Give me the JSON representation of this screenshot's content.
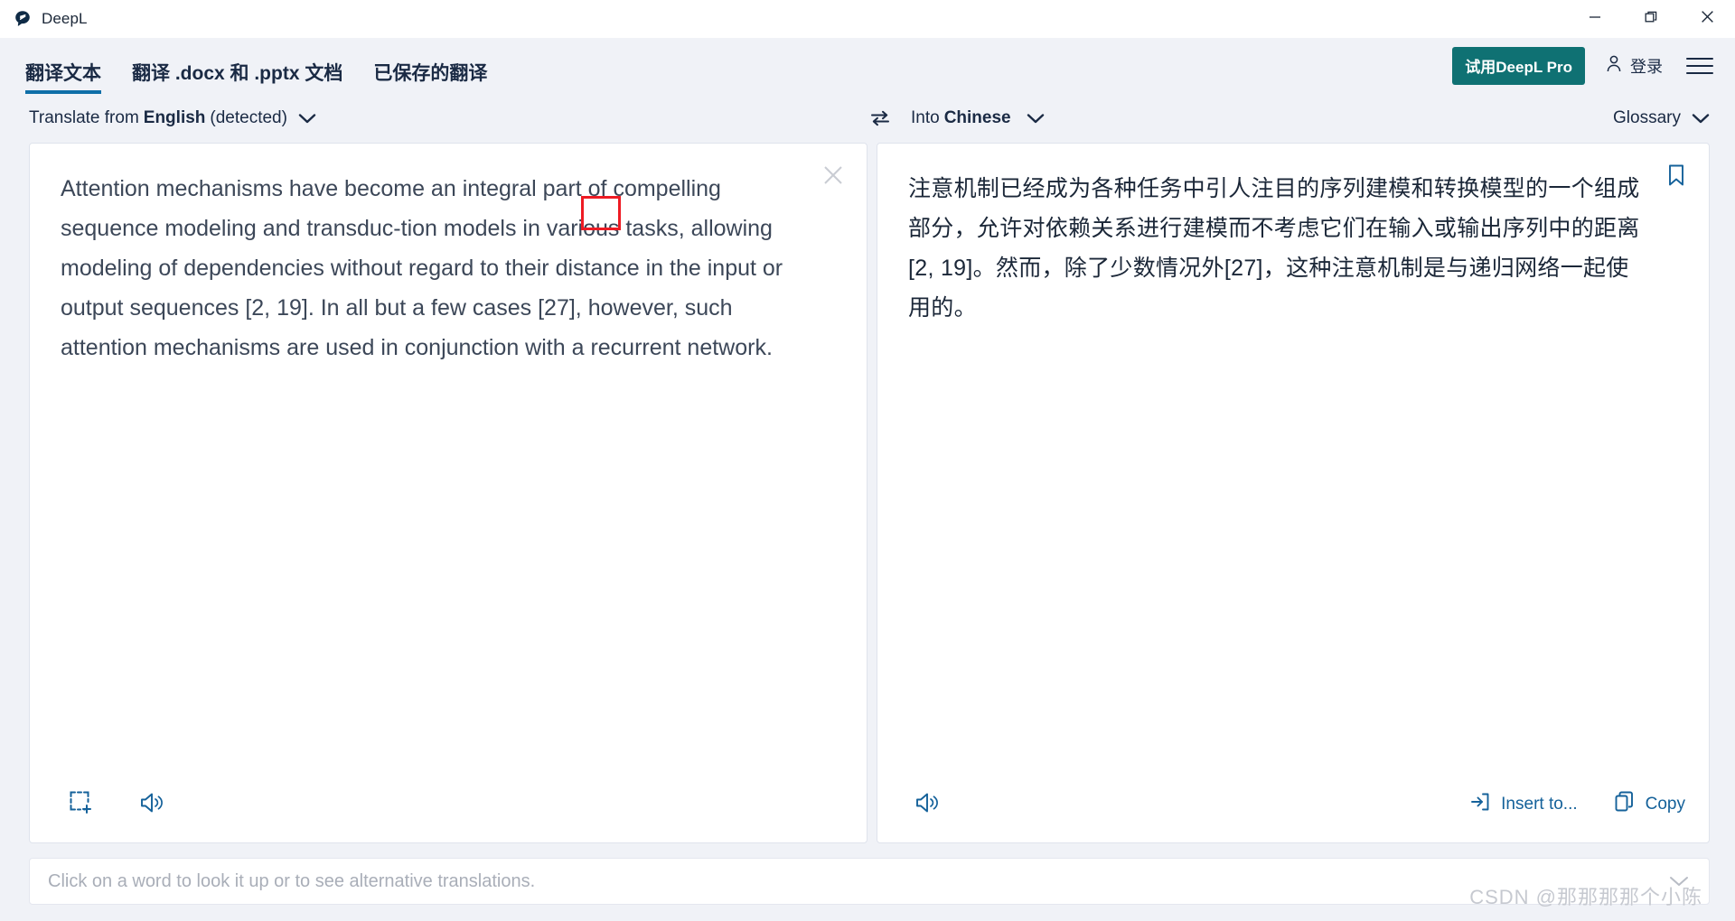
{
  "window": {
    "app_title": "DeepL",
    "logo_icon": "deepl-logo-icon",
    "minimize_icon": "minimize-icon",
    "restore_icon": "restore-icon",
    "close_icon": "close-icon"
  },
  "nav": {
    "tabs": [
      {
        "label": "翻译文本",
        "active": true
      },
      {
        "label": "翻译 .docx 和 .pptx 文档",
        "active": false
      },
      {
        "label": "已保存的翻译",
        "active": false
      }
    ],
    "pro_button": "试用DeepL Pro",
    "login_label": "登录",
    "login_icon": "person-icon",
    "menu_icon": "hamburger-menu-icon",
    "active_tab_color": "#0f6fa8",
    "pro_button_color": "#0f7173"
  },
  "language_bar": {
    "source_prefix": "Translate from",
    "source_language": "English",
    "source_suffix": "(detected)",
    "source_chevron_icon": "chevron-down-icon",
    "swap_icon": "swap-languages-icon",
    "target_prefix": "Into",
    "target_language": "Chinese",
    "target_chevron_icon": "chevron-down-icon",
    "glossary_label": "Glossary",
    "glossary_chevron_icon": "chevron-down-icon"
  },
  "source_panel": {
    "text": "Attention mechanisms have become an integral part of compelling sequence modeling and transduc-tion models in various tasks, allowing modeling of dependencies without regard to their distance in the input or output sequences [2, 19]. In all but a few cases [27], however, such attention mechanisms are used in conjunction with a recurrent network.",
    "clear_icon": "close-icon",
    "capture_icon": "screenshot-capture-icon",
    "speaker_icon": "speaker-icon"
  },
  "target_panel": {
    "text": "注意机制已经成为各种任务中引人注目的序列建模和转换模型的一个组成部分，允许对依赖关系进行建模而不考虑它们在输入或输出序列中的距离[2, 19]。然而，除了少数情况外[27]，这种注意机制是与递归网络一起使用的。",
    "bookmark_icon": "bookmark-icon",
    "speaker_icon": "speaker-icon",
    "insert_label": "Insert to...",
    "insert_icon": "insert-arrow-icon",
    "copy_label": "Copy",
    "copy_icon": "copy-icon"
  },
  "dictionary_bar": {
    "placeholder": "Click on a word to look it up or to see alternative translations.",
    "chevron_icon": "chevron-down-icon"
  },
  "annotation": {
    "red_box_color": "#ee1b24"
  },
  "watermark": {
    "text": "CSDN @那那那那个小陈"
  }
}
